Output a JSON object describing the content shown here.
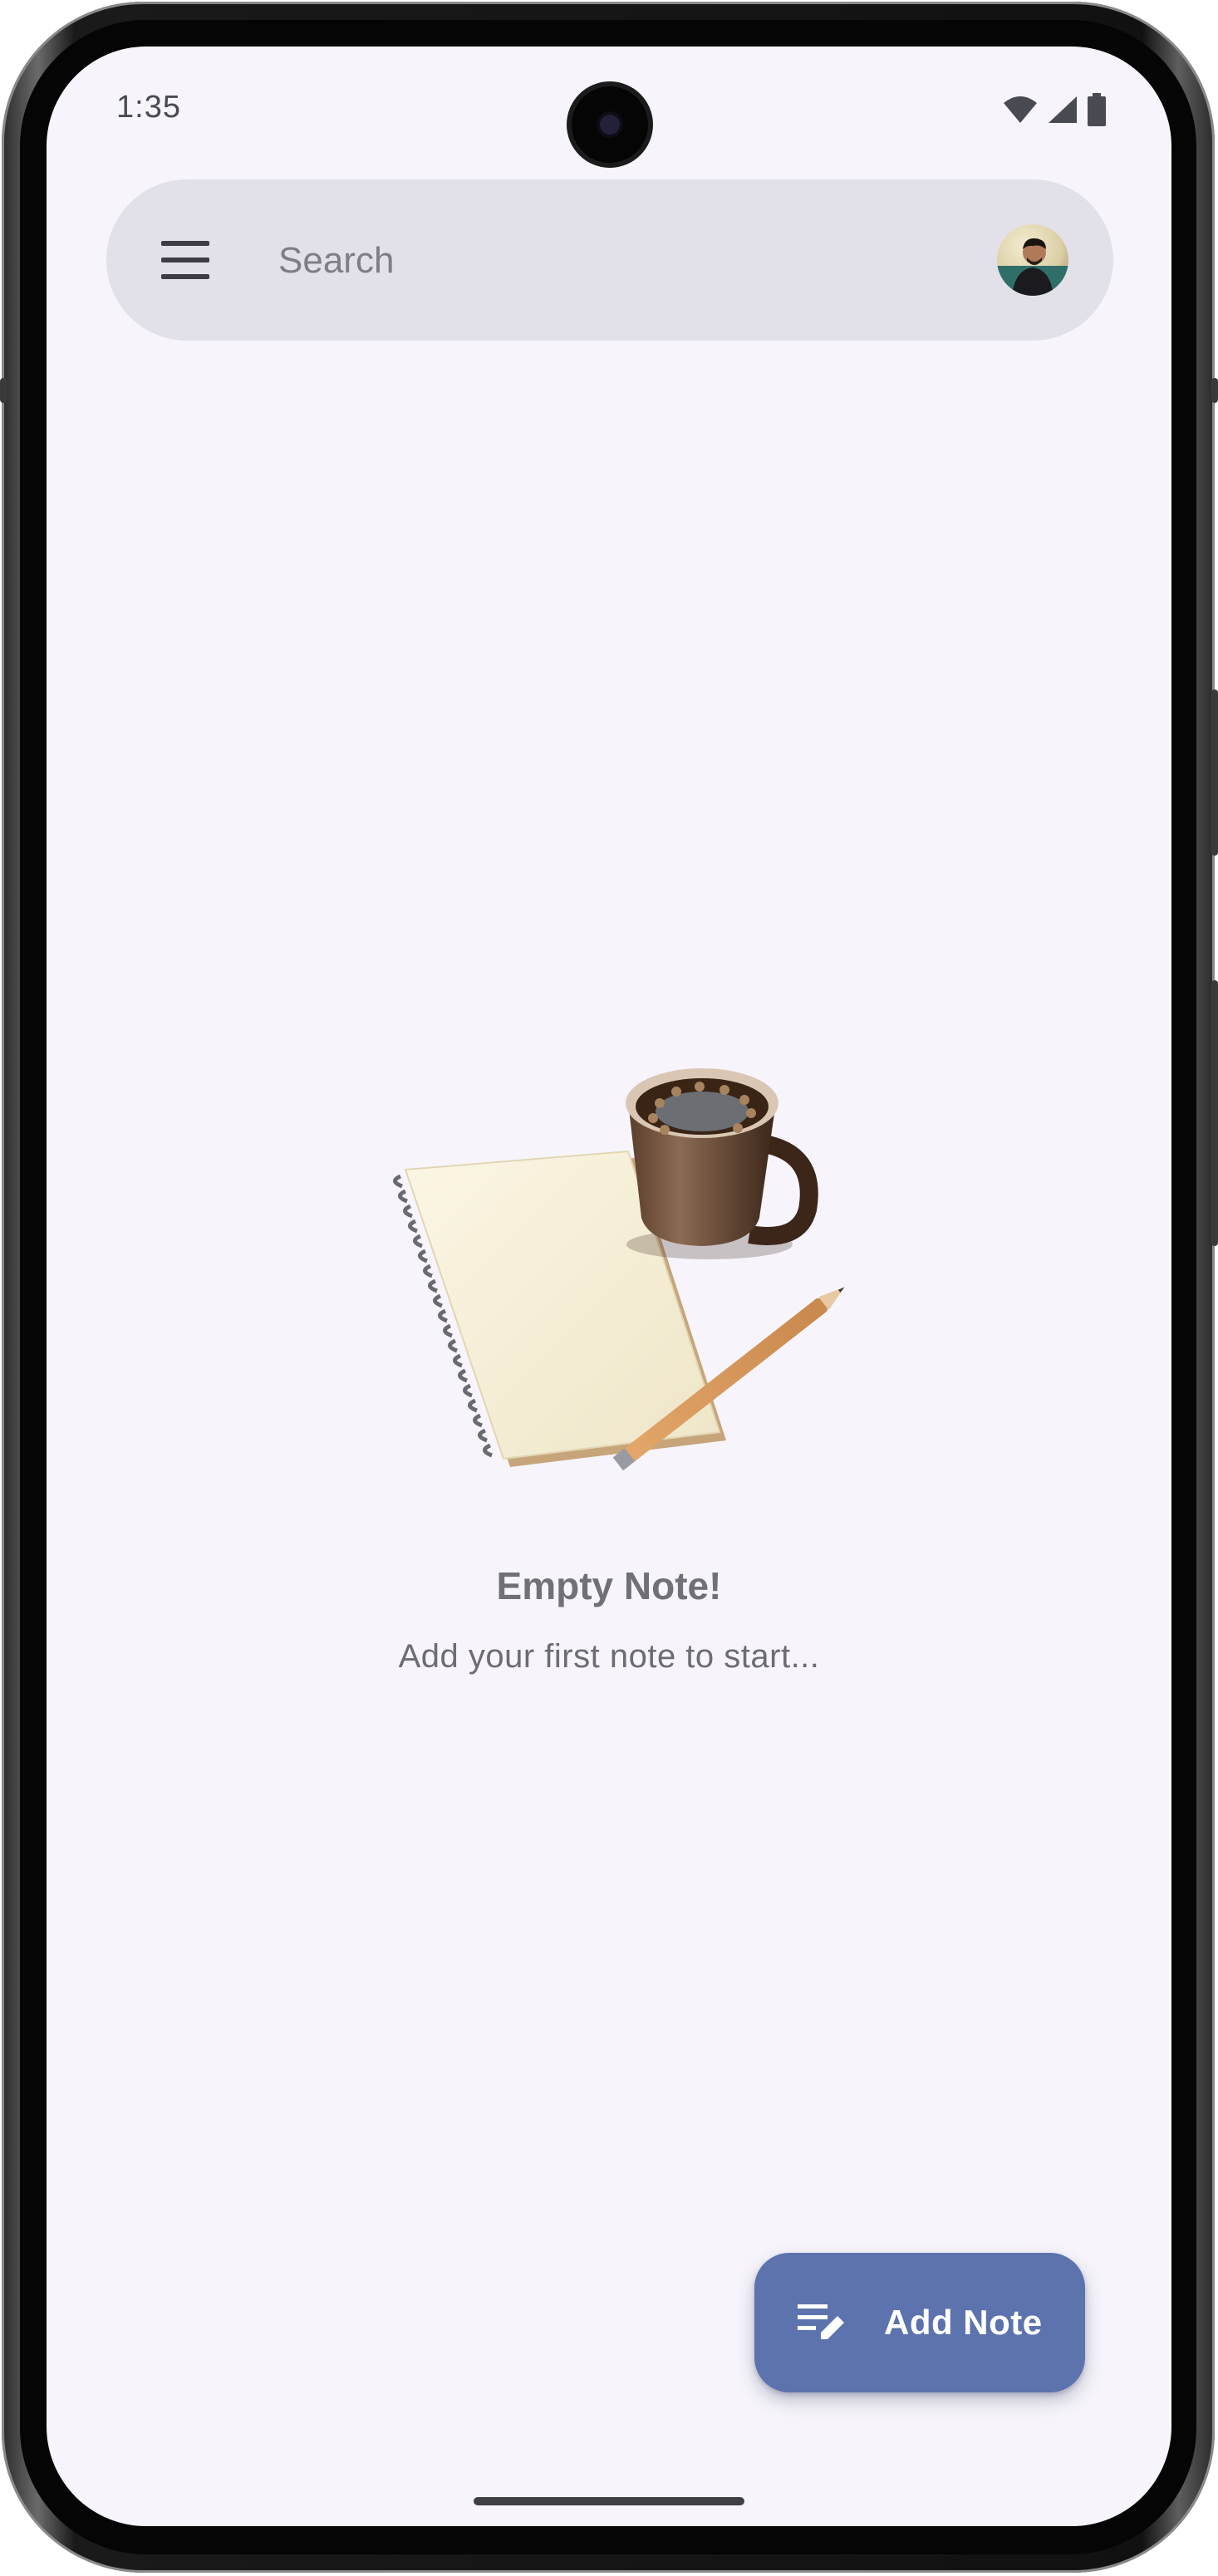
{
  "status_bar": {
    "time": "1:35",
    "icons": [
      "wifi-icon",
      "cell-signal-icon",
      "battery-icon"
    ]
  },
  "search": {
    "placeholder": "Search",
    "menu_icon": "menu-icon",
    "avatar": "profile-avatar"
  },
  "empty_state": {
    "illustration": "notebook-coffee-pencil-illustration",
    "title": "Empty Note!",
    "subtitle": "Add your first note to start..."
  },
  "fab": {
    "icon": "edit-note-icon",
    "label": "Add Note"
  },
  "colors": {
    "background": "#f7f5fb",
    "search_bar": "#e2e1ea",
    "fab": "#5c73ad",
    "text_muted": "#707077"
  }
}
